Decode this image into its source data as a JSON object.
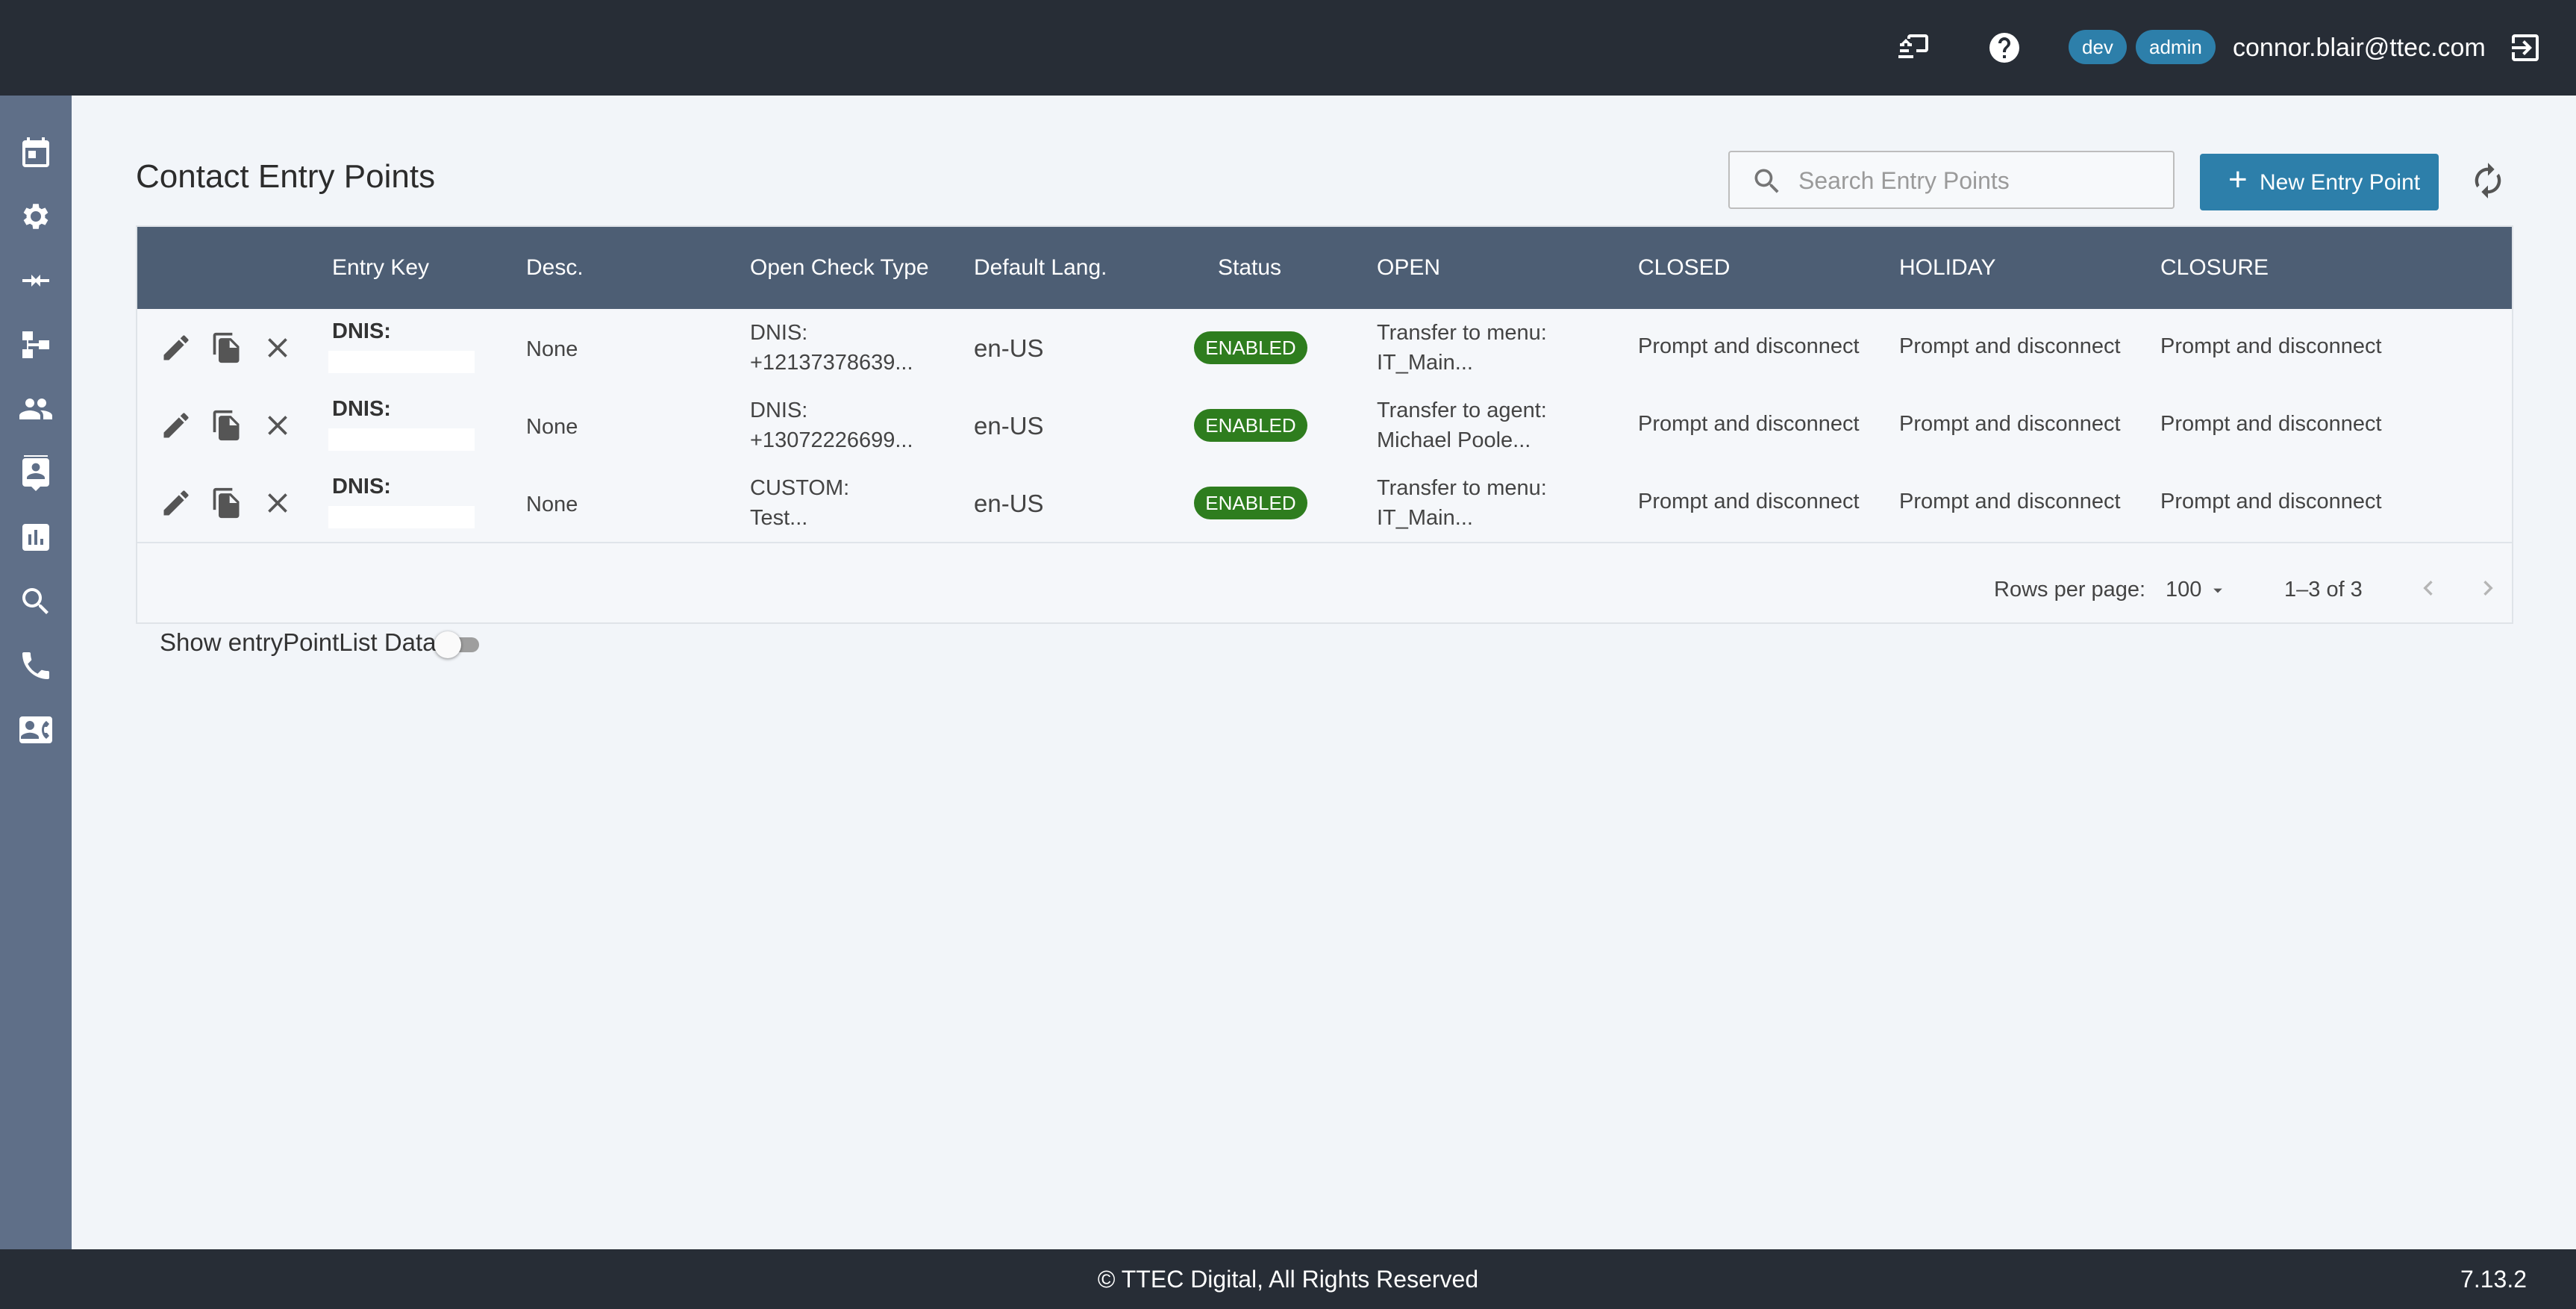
{
  "header": {
    "env_badge": "dev",
    "role_badge": "admin",
    "user_email": "connor.blair@ttec.com",
    "icons": [
      "screen-share-icon",
      "help-icon",
      "logout-icon"
    ]
  },
  "sidebar": {
    "items": [
      {
        "icon": "calendar-icon"
      },
      {
        "icon": "settings-icon"
      },
      {
        "icon": "merge-arrows-icon"
      },
      {
        "icon": "hierarchy-icon"
      },
      {
        "icon": "people-icon"
      },
      {
        "icon": "contact-book-icon"
      },
      {
        "icon": "bar-chart-icon"
      },
      {
        "icon": "search-icon"
      },
      {
        "icon": "phone-icon"
      },
      {
        "icon": "contact-card-icon"
      }
    ]
  },
  "page": {
    "title": "Contact Entry Points",
    "search_placeholder": "Search Entry Points",
    "new_button": "New Entry Point"
  },
  "table": {
    "columns": [
      "Entry Key",
      "Desc.",
      "Open Check Type",
      "Default Lang.",
      "Status",
      "OPEN",
      "CLOSED",
      "HOLIDAY",
      "CLOSURE"
    ],
    "rows": [
      {
        "entry_key": "DNIS:",
        "desc": "None",
        "check_type_1": "DNIS:",
        "check_type_2": "+12137378639...",
        "lang": "en-US",
        "status": "ENABLED",
        "open_1": "Transfer to menu:",
        "open_2": "IT_Main...",
        "closed": "Prompt and disconnect",
        "holiday": "Prompt and disconnect",
        "closure": "Prompt and disconnect"
      },
      {
        "entry_key": "DNIS:",
        "desc": "None",
        "check_type_1": "DNIS:",
        "check_type_2": "+13072226699...",
        "lang": "en-US",
        "status": "ENABLED",
        "open_1": "Transfer to agent:",
        "open_2": "Michael Poole...",
        "closed": "Prompt and disconnect",
        "holiday": "Prompt and disconnect",
        "closure": "Prompt and disconnect"
      },
      {
        "entry_key": "DNIS:",
        "desc": "None",
        "check_type_1": "CUSTOM:",
        "check_type_2": "Test...",
        "lang": "en-US",
        "status": "ENABLED",
        "open_1": "Transfer to menu:",
        "open_2": "IT_Main...",
        "closed": "Prompt and disconnect",
        "holiday": "Prompt and disconnect",
        "closure": "Prompt and disconnect"
      }
    ],
    "pagination": {
      "rows_per_page_label": "Rows per page:",
      "rows_per_page": "100",
      "range": "1–3 of 3"
    }
  },
  "toggle": {
    "label": "Show entryPointList Data",
    "checked": false
  },
  "footer": {
    "copyright": "© TTEC Digital, All Rights Reserved",
    "version": "7.13.2"
  },
  "colors": {
    "topbar": "#272d36",
    "sidebar": "#5f6f88",
    "table_header": "#4d5e74",
    "primary": "#2d7faa",
    "enabled": "#2e7d1e"
  }
}
